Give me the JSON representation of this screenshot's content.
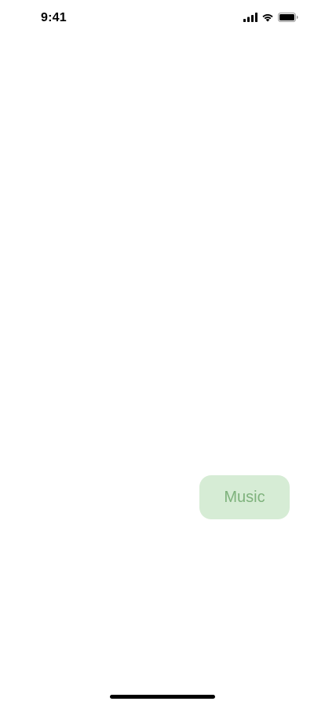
{
  "status_bar": {
    "time": "9:41",
    "icons": [
      "cellular-signal-icon",
      "wifi-icon",
      "battery-icon"
    ]
  },
  "main": {
    "music_button_label": "Music"
  },
  "colors": {
    "background": "#ffffff",
    "music_button_bg": "#d6ecd5",
    "music_button_text": "#7eb27c",
    "status_text": "#000000"
  }
}
